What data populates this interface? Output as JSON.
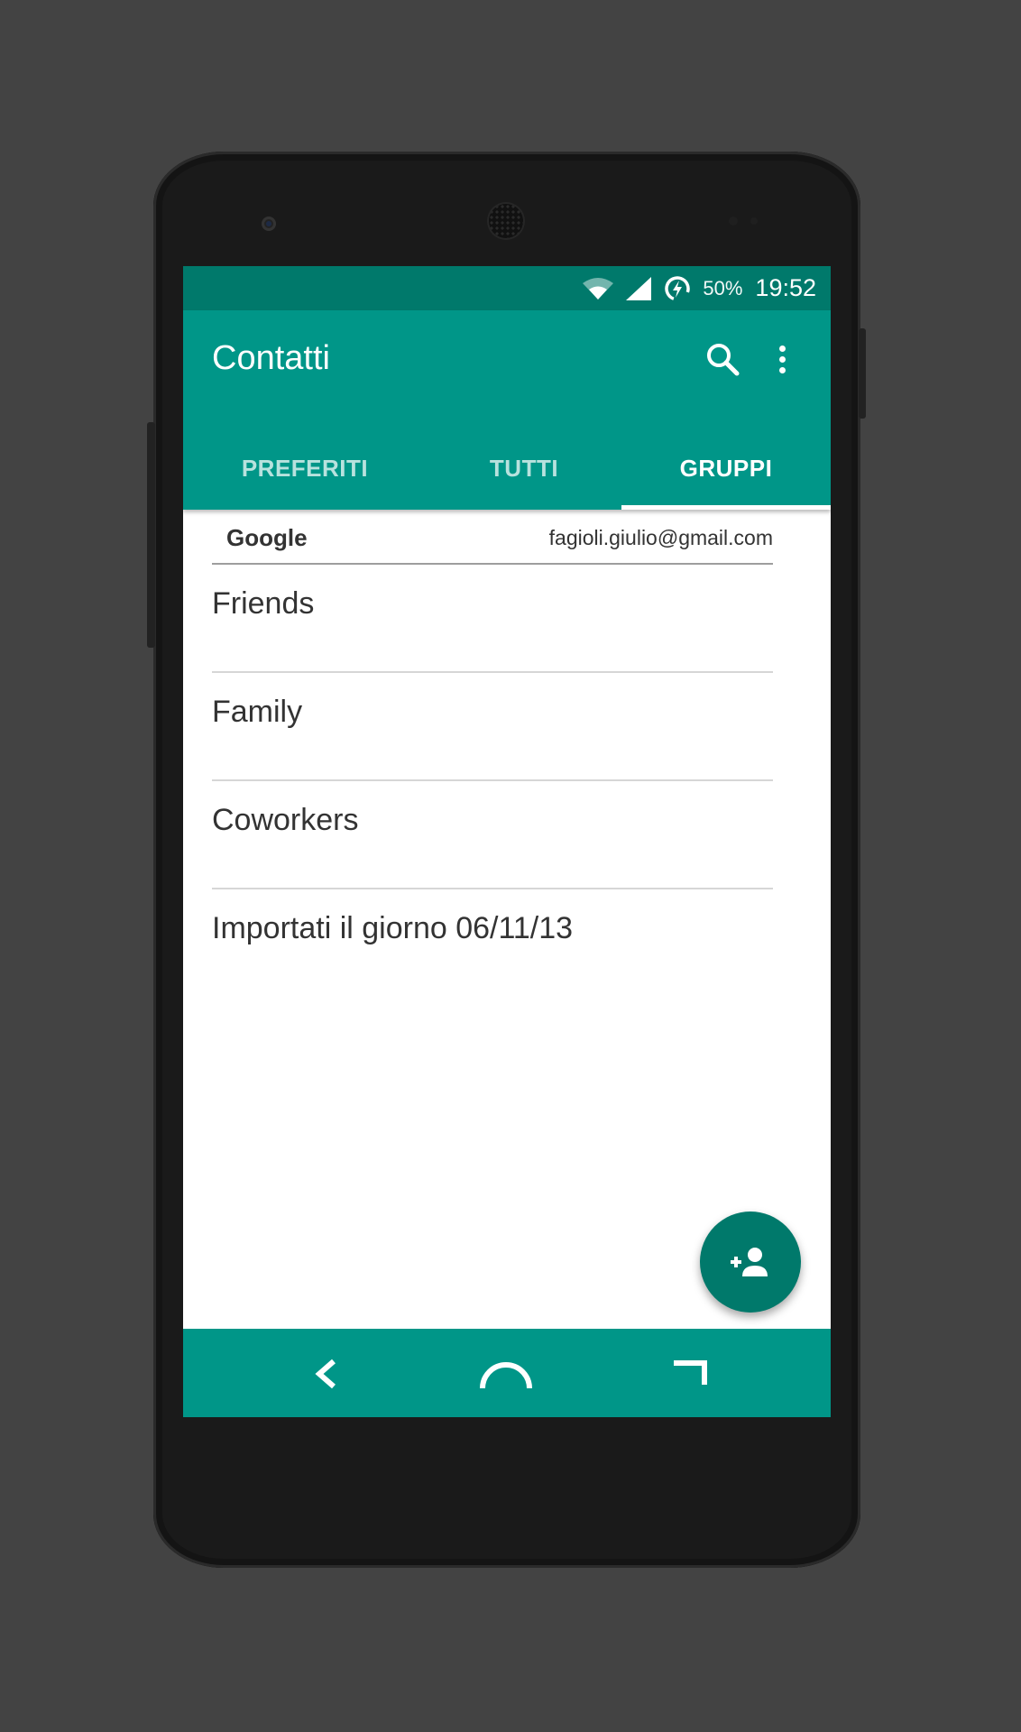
{
  "status_bar": {
    "battery": "50%",
    "time": "19:52"
  },
  "app_bar": {
    "title": "Contatti",
    "actions": [
      "search-icon",
      "overflow-menu-icon"
    ]
  },
  "tabs": [
    {
      "label": "PREFERITI",
      "active": false
    },
    {
      "label": "TUTTI",
      "active": false
    },
    {
      "label": "GRUPPI",
      "active": true
    }
  ],
  "account": {
    "type": "Google",
    "email": "fagioli.giulio@gmail.com"
  },
  "groups": [
    {
      "name": "Friends"
    },
    {
      "name": "Family"
    },
    {
      "name": "Coworkers"
    },
    {
      "name": "Importati il giorno 06/11/13"
    }
  ],
  "fab": {
    "icon": "add-person-icon"
  },
  "nav_bar": {
    "buttons": [
      "back-icon",
      "home-icon",
      "recents-icon"
    ]
  },
  "colors": {
    "primary": "#009688",
    "primary_dark": "#00796b",
    "background": "#434343"
  }
}
